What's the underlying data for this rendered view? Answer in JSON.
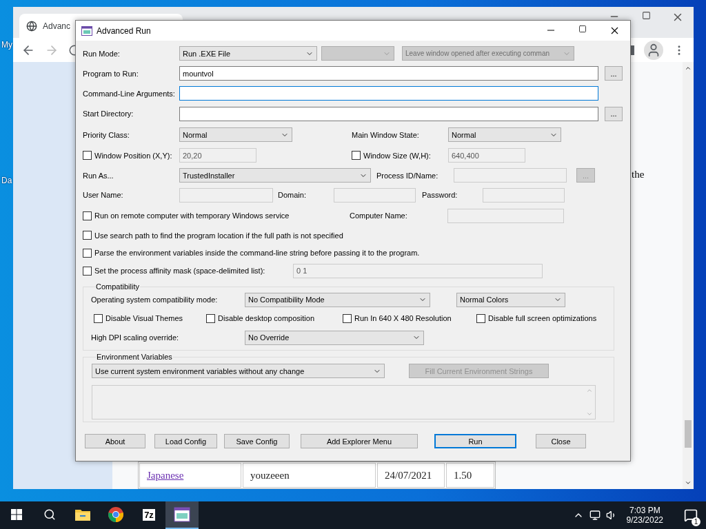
{
  "desktop": {
    "icon_labels": [
      "My",
      "Da"
    ]
  },
  "browser": {
    "tab_title": "Advanc",
    "page_text": "the",
    "table_row": [
      {
        "text": "Japanese",
        "kind": "link"
      },
      {
        "text": "youzeeen",
        "kind": "text"
      },
      {
        "text": "24/07/2021",
        "kind": "text"
      },
      {
        "text": "1.50",
        "kind": "text"
      }
    ]
  },
  "dialog": {
    "title": "Advanced Run",
    "run_mode": {
      "label": "Run Mode:",
      "value": "Run .EXE File"
    },
    "sub_mode": {
      "disabled": true
    },
    "leave_window": {
      "value": "Leave window opened after executing comman",
      "disabled": true
    },
    "program": {
      "label": "Program to Run:",
      "value": "mountvol",
      "browse": "..."
    },
    "arguments": {
      "label": "Command-Line Arguments:",
      "focused": true
    },
    "start_directory": {
      "label": "Start Directory:",
      "browse": "..."
    },
    "priority": {
      "label": "Priority Class:",
      "value": "Normal"
    },
    "main_window_state": {
      "label": "Main Window State:",
      "value": "Normal"
    },
    "window_position": {
      "label": "Window Position (X,Y):",
      "checked": false,
      "value": "20,20",
      "disabled": true
    },
    "window_size": {
      "label": "Window Size (W,H):",
      "checked": false,
      "value": "640,400",
      "disabled": true
    },
    "run_as": {
      "label": "Run As...",
      "value": "TrustedInstaller"
    },
    "process": {
      "label": "Process ID/Name:",
      "disabled": true,
      "browse": "..."
    },
    "user_name": {
      "label": "User Name:",
      "disabled": true
    },
    "domain": {
      "label": "Domain:",
      "disabled": true
    },
    "password": {
      "label": "Password:",
      "disabled": true
    },
    "remote": {
      "label": "Run on remote computer with temporary Windows service",
      "checked": false
    },
    "computer_name": {
      "label": "Computer Name:",
      "disabled": true
    },
    "options": [
      {
        "label": "Use search path to find the program location if the full path is not specified",
        "checked": false
      },
      {
        "label": "Parse the environment variables inside the command-line string before passing it to the program.",
        "checked": false
      }
    ],
    "affinity": {
      "label": "Set the process affinity mask (space-delimited list):",
      "checked": false,
      "value": "0 1",
      "disabled": true
    },
    "compatibility": {
      "title": "Compatibility",
      "os_mode": {
        "label": "Operating system compatibility mode:",
        "value": "No Compatibility Mode"
      },
      "colors": {
        "value": "Normal Colors"
      },
      "checks": [
        {
          "label": "Disable Visual Themes",
          "checked": false
        },
        {
          "label": "Disable desktop composition",
          "checked": false
        },
        {
          "label": "Run In 640 X 480 Resolution",
          "checked": false
        },
        {
          "label": "Disable full screen optimizations",
          "checked": false
        }
      ],
      "dpi": {
        "label": "High DPI scaling override:",
        "value": "No Override"
      }
    },
    "environment": {
      "title": "Environment Variables",
      "mode": {
        "value": "Use current system environment variables without any change"
      },
      "fill_button": {
        "label": "Fill Current Environment Strings",
        "disabled": true
      }
    },
    "buttons": [
      {
        "label": "About",
        "default": false
      },
      {
        "label": "Load Config",
        "default": false
      },
      {
        "label": "Save Config",
        "default": false
      },
      {
        "label": "Add Explorer Menu",
        "default": false
      },
      {
        "label": "Run",
        "default": true
      },
      {
        "label": "Close",
        "default": false
      }
    ]
  },
  "taskbar": {
    "apps": [
      {
        "kind": "explorer",
        "active": false
      },
      {
        "kind": "chrome",
        "active": false
      },
      {
        "kind": "sevenzip",
        "glyph": "7z",
        "active": false
      },
      {
        "kind": "advanced-run",
        "active": true
      }
    ],
    "time": "7:03 PM",
    "date": "9/23/2022",
    "notifications": "1"
  }
}
